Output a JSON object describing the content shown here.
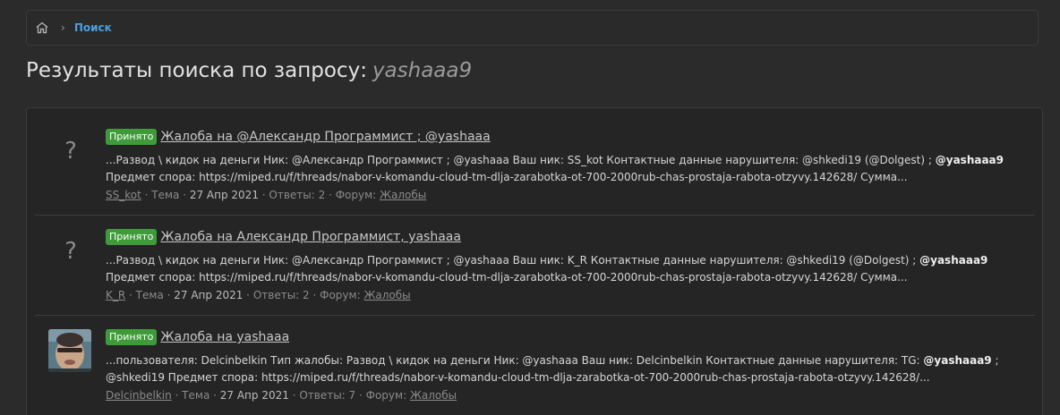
{
  "breadcrumb": {
    "current": "Поиск"
  },
  "page": {
    "title_prefix": "Результаты поиска по запросу:",
    "query": "yashaaa9"
  },
  "results": [
    {
      "badge": "Принято",
      "title": "Жалоба на @Александр Программист ; @yashaaa",
      "avatar": "?",
      "snippet_line1_a": "...Развод \\ кидок на деньги Ник: @Александр Программист ; @yashaaa Ваш ник: SS_kot Контактные данные нарушителя: @shkedi19 (@Dolgest) ; ",
      "snippet_line1_hl": "@yashaaa9",
      "snippet_line2": "Предмет спора: https://miped.ru/f/threads/nabor-v-komandu-cloud-tm-dlja-zarabotka-ot-700-2000rub-chas-prostaja-rabota-otzyvy.142628/ Сумма...",
      "author": "SS_kot",
      "type": "Тема",
      "date": "27 Апр 2021",
      "replies": "Ответы: 2",
      "forum_label": "Форум:",
      "forum": "Жалобы"
    },
    {
      "badge": "Принято",
      "title": "Жалоба на Александр Программист, yashaaa",
      "avatar": "?",
      "snippet_line1_a": "...Развод \\ кидок на деньги Ник: @Александр Программист ; @yashaaa Ваш ник: K_R Контактные данные нарушителя: @shkedi19 (@Dolgest) ; ",
      "snippet_line1_hl": "@yashaaa9",
      "snippet_line2": "Предмет спора: https://miped.ru/f/threads/nabor-v-komandu-cloud-tm-dlja-zarabotka-ot-700-2000rub-chas-prostaja-rabota-otzyvy.142628/ Сумма...",
      "author": "K_R",
      "type": "Тема",
      "date": "27 Апр 2021",
      "replies": "Ответы: 2",
      "forum_label": "Форум:",
      "forum": "Жалобы"
    },
    {
      "badge": "Принято",
      "title": "Жалоба на yashaaa",
      "snippet_line1_a": "...пользователя: Delcinbelkin Тип жалобы: Развод \\ кидок на деньги Ник: @yashaaa Ваш ник: Delcinbelkin Контактные данные нарушителя: TG: ",
      "snippet_line1_hl": "@yashaaa9",
      "snippet_line1_b": " ;",
      "snippet_line2": "@shkedi19 Предмет спора: https://miped.ru/f/threads/nabor-v-komandu-cloud-tm-dlja-zarabotka-ot-700-2000rub-chas-prostaja-rabota-otzyvy.142628/...",
      "author": "Delcinbelkin",
      "type": "Тема",
      "date": "27 Апр 2021",
      "replies": "Ответы: 7",
      "forum_label": "Форум:",
      "forum": "Жалобы"
    }
  ]
}
